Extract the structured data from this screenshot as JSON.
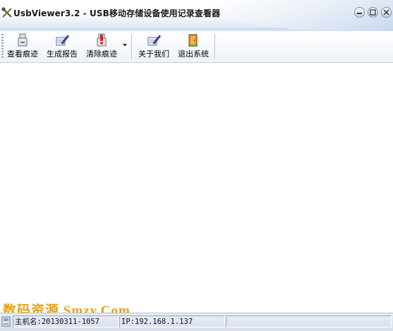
{
  "window": {
    "title": "UsbViewer3.2 - USB移动存储设备使用记录查看器",
    "minimize_icon": "minimize-icon",
    "close_icon": "close-icon"
  },
  "toolbar": {
    "view_traces_label": "查看痕迹",
    "generate_report_label": "生成报告",
    "clear_traces_label": "清除痕迹",
    "about_label": "关于我们",
    "exit_label": "退出系统"
  },
  "watermark": {
    "text": "数码资源 Smzy.Com"
  },
  "statusbar": {
    "hostname": "主机名:20130311-1057",
    "ip": "IP:192.168.1.137"
  },
  "colors": {
    "title_bg": "#dfe8f5",
    "watermark": "#e8a214"
  }
}
